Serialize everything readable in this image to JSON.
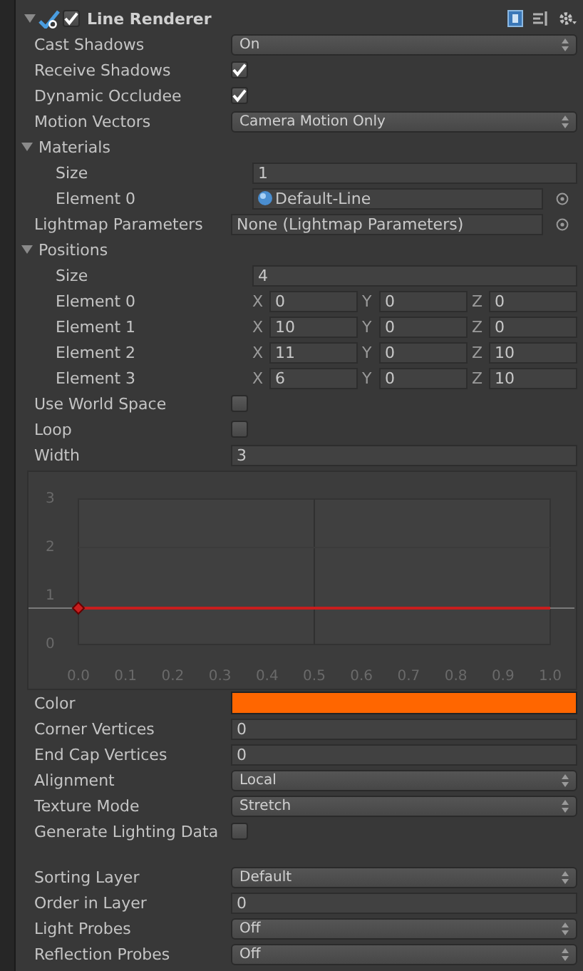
{
  "component": {
    "title": "Line Renderer",
    "enabled": true,
    "expanded": true
  },
  "rows": [
    {
      "kind": "dropdown",
      "label": "Cast Shadows",
      "value": "On"
    },
    {
      "kind": "checkbox",
      "label": "Receive Shadows",
      "checked": true
    },
    {
      "kind": "checkbox",
      "label": "Dynamic Occludee",
      "checked": true
    },
    {
      "kind": "dropdown",
      "label": "Motion Vectors",
      "value": "Camera Motion Only"
    },
    {
      "kind": "foldout",
      "label": "Materials",
      "expanded": true,
      "children": [
        {
          "kind": "field",
          "label": "Size",
          "value": "1"
        },
        {
          "kind": "object",
          "label": "Element 0",
          "value": "Default-Line",
          "thumbnail": true
        }
      ]
    },
    {
      "kind": "object",
      "label": "Lightmap Parameters",
      "value": "None (Lightmap Parameters)",
      "thumbnail": false
    },
    {
      "kind": "foldout",
      "label": "Positions",
      "expanded": true,
      "children": [
        {
          "kind": "field",
          "label": "Size",
          "value": "4"
        },
        {
          "kind": "vector3",
          "label": "Element 0",
          "components": [
            {
              "axis": "X",
              "value": "0"
            },
            {
              "axis": "Y",
              "value": "0"
            },
            {
              "axis": "Z",
              "value": "0"
            }
          ]
        },
        {
          "kind": "vector3",
          "label": "Element 1",
          "components": [
            {
              "axis": "X",
              "value": "10"
            },
            {
              "axis": "Y",
              "value": "0"
            },
            {
              "axis": "Z",
              "value": "0"
            }
          ]
        },
        {
          "kind": "vector3",
          "label": "Element 2",
          "components": [
            {
              "axis": "X",
              "value": "11"
            },
            {
              "axis": "Y",
              "value": "0"
            },
            {
              "axis": "Z",
              "value": "10"
            }
          ]
        },
        {
          "kind": "vector3",
          "label": "Element 3",
          "components": [
            {
              "axis": "X",
              "value": "6"
            },
            {
              "axis": "Y",
              "value": "0"
            },
            {
              "axis": "Z",
              "value": "10"
            }
          ]
        }
      ]
    },
    {
      "kind": "checkbox",
      "label": "Use World Space",
      "checked": false
    },
    {
      "kind": "checkbox",
      "label": "Loop",
      "checked": false
    },
    {
      "kind": "field",
      "label": "Width",
      "value": "3"
    },
    {
      "kind": "curve",
      "chart_data": {
        "type": "line",
        "x": [
          0.0,
          1.0
        ],
        "series": [
          {
            "color": "#c81e1e",
            "values": [
              0.75,
              0.75
            ]
          }
        ],
        "ref_lines": [
          {
            "axis": "x",
            "value": 0.5,
            "color": "#303030"
          },
          {
            "axis": "y",
            "value": 2,
            "color": "#3b3b3b"
          },
          {
            "axis": "y",
            "value": 0.75,
            "color": "#7a7a7a"
          }
        ],
        "xlim": [
          0.0,
          1.0
        ],
        "ylim": [
          0,
          3
        ],
        "xticks": [
          {
            "value": 0.0,
            "label": "0.0"
          },
          {
            "value": 0.1,
            "label": "0.1"
          },
          {
            "value": 0.2,
            "label": "0.2"
          },
          {
            "value": 0.3,
            "label": "0.3"
          },
          {
            "value": 0.4,
            "label": "0.4"
          },
          {
            "value": 0.5,
            "label": "0.5"
          },
          {
            "value": 0.6,
            "label": "0.6"
          },
          {
            "value": 0.7,
            "label": "0.7"
          },
          {
            "value": 0.8,
            "label": "0.8"
          },
          {
            "value": 0.9,
            "label": "0.9"
          },
          {
            "value": 1.0,
            "label": "1.0"
          }
        ],
        "yticks": [
          0,
          1,
          2,
          3
        ]
      }
    },
    {
      "kind": "color",
      "label": "Color",
      "color": "#ff6600"
    },
    {
      "kind": "field",
      "label": "Corner Vertices",
      "value": "0"
    },
    {
      "kind": "field",
      "label": "End Cap Vertices",
      "value": "0"
    },
    {
      "kind": "dropdown",
      "label": "Alignment",
      "value": "Local"
    },
    {
      "kind": "dropdown",
      "label": "Texture Mode",
      "value": "Stretch"
    },
    {
      "kind": "checkbox",
      "label": "Generate Lighting Data",
      "checked": false
    }
  ],
  "renderer_rows": [
    {
      "kind": "dropdown",
      "label": "Sorting Layer",
      "value": "Default"
    },
    {
      "kind": "field",
      "label": "Order in Layer",
      "value": "0"
    },
    {
      "kind": "dropdown",
      "label": "Light Probes",
      "value": "Off"
    },
    {
      "kind": "dropdown",
      "label": "Reflection Probes",
      "value": "Off"
    }
  ]
}
